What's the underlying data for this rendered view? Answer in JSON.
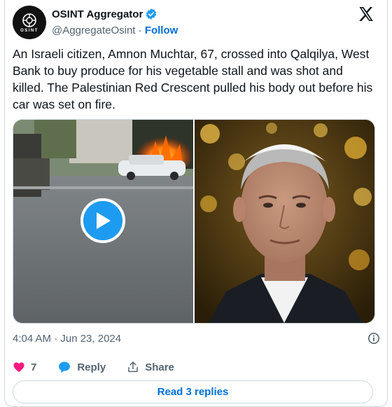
{
  "author": {
    "display_name": "OSINT Aggregator",
    "handle": "@AggregateOsint",
    "separator": " · ",
    "follow_label": "Follow",
    "avatar_text": "OSINT",
    "verified": true
  },
  "tweet": {
    "text": "An Israeli citizen, Amnon Muchtar, 67, crossed into Qalqilya, West Bank to buy produce for his vegetable stall and was shot and killed. The Palestinian Red Crescent pulled his body out before his car was set on fire.",
    "timestamp": "4:04 AM · Jun 23, 2024"
  },
  "media": {
    "left": {
      "type": "video",
      "icon": "play-icon"
    },
    "right": {
      "type": "photo"
    }
  },
  "actions": {
    "like_count": "7",
    "reply_label": "Reply",
    "share_label": "Share"
  },
  "footer": {
    "read_replies_label": "Read 3 replies"
  },
  "colors": {
    "accent": "#1d9bf0",
    "link": "#006fd6",
    "like": "#f91880",
    "secondary_text": "#536471",
    "border": "#cfd9de"
  },
  "icons": [
    "osint-logo-icon",
    "verified-badge-icon",
    "x-logo-icon",
    "play-icon",
    "info-icon",
    "heart-icon",
    "reply-bubble-icon",
    "share-icon"
  ]
}
